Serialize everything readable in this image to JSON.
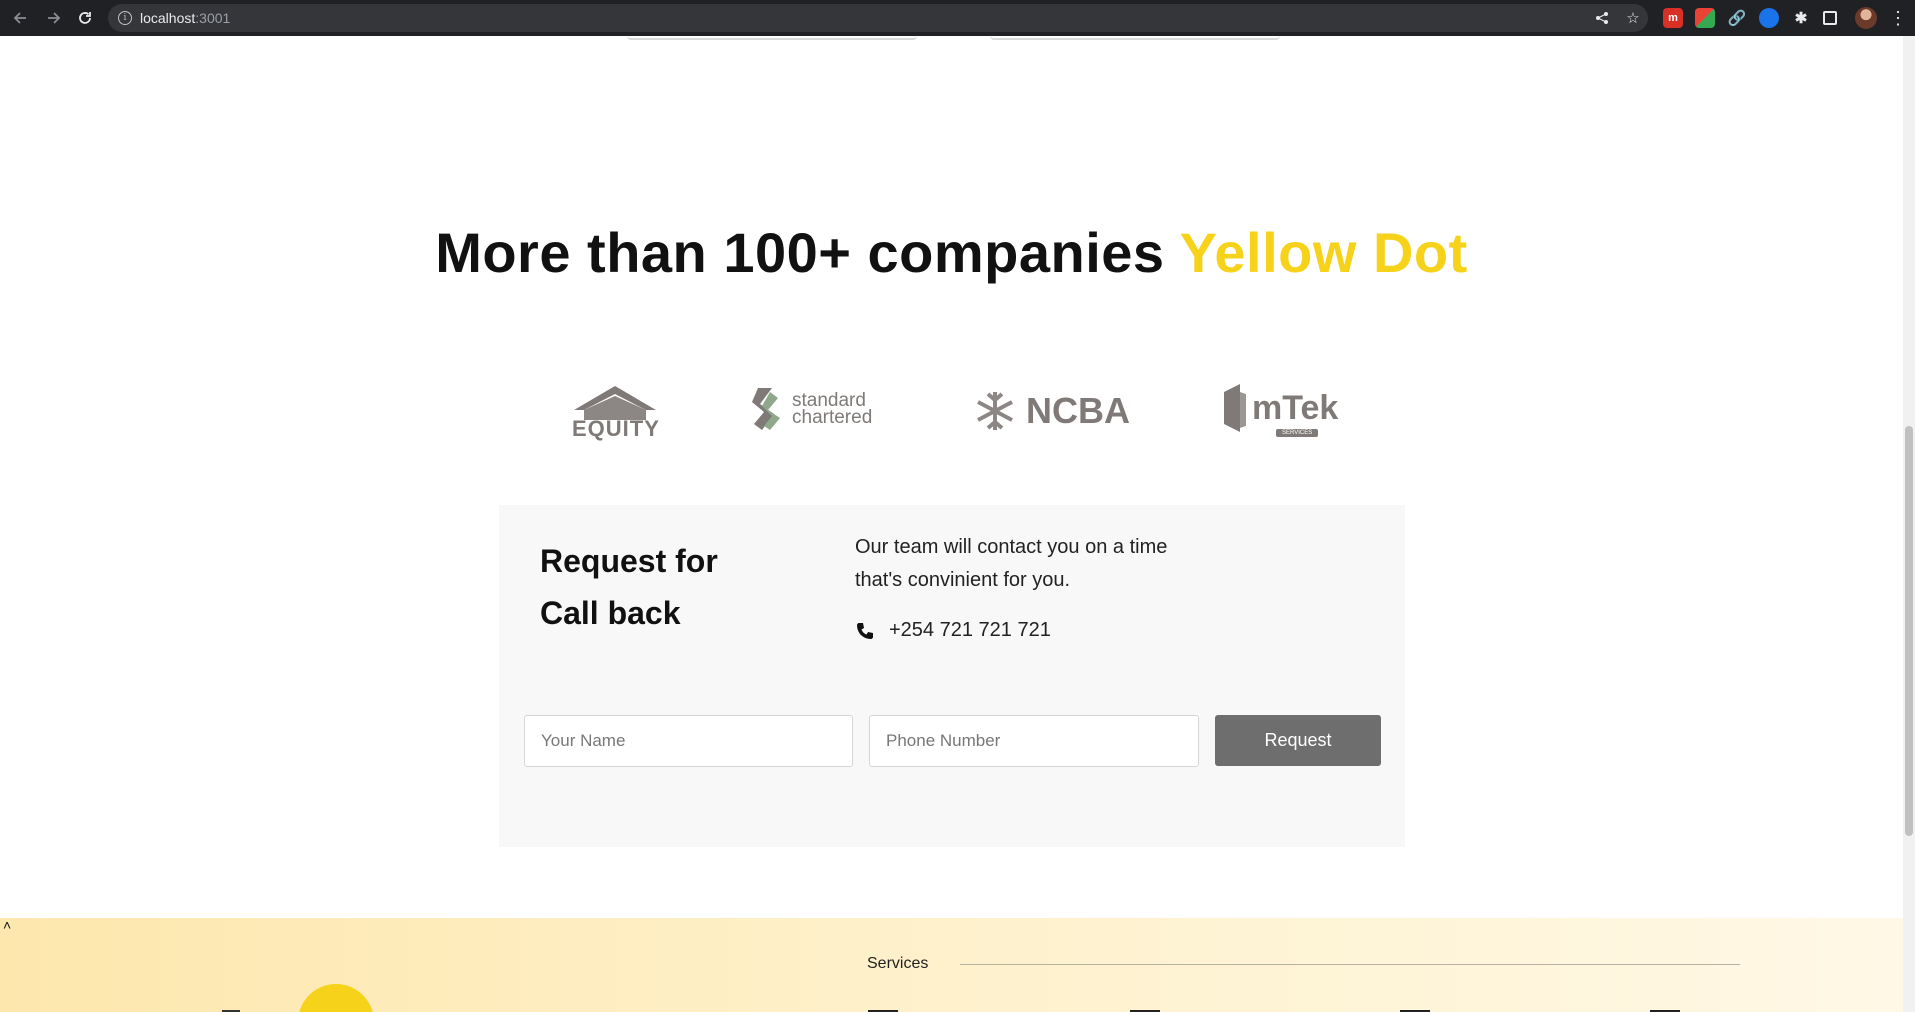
{
  "browser": {
    "url_host": "localhost",
    "url_port": ":3001"
  },
  "headline": {
    "text": "More than 100+ companies",
    "accent": "Yellow Dot",
    "accent_color": "#f7d21a"
  },
  "logos": [
    {
      "name": "EQUITY"
    },
    {
      "name": "standard",
      "name2": "chartered"
    },
    {
      "name": "NCBA"
    },
    {
      "name": "mTek",
      "sub": "SERVICES"
    }
  ],
  "callback": {
    "title_line1": "Request for",
    "title_line2": "Call back",
    "description": "Our team will contact you on a time that's convinient for you.",
    "phone": "+254 721 721 721",
    "name_placeholder": "Your Name",
    "phone_placeholder": "Phone Number",
    "button_label": "Request"
  },
  "footer": {
    "services_label": "Services"
  }
}
